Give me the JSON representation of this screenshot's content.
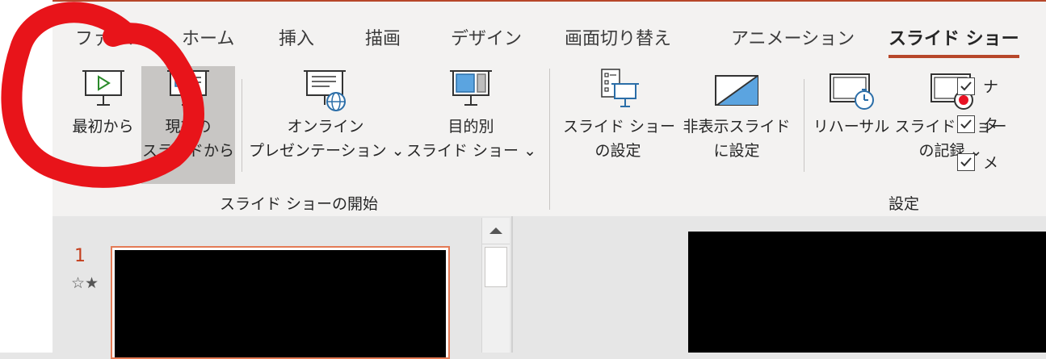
{
  "tabs": [
    {
      "id": "file",
      "label": "ファイル"
    },
    {
      "id": "home",
      "label": "ホーム"
    },
    {
      "id": "insert",
      "label": "挿入"
    },
    {
      "id": "draw",
      "label": "描画"
    },
    {
      "id": "design",
      "label": "デザイン"
    },
    {
      "id": "transitions",
      "label": "画面切り替え"
    },
    {
      "id": "animations",
      "label": "アニメーション"
    },
    {
      "id": "slideshow",
      "label": "スライド ショー",
      "active": true
    }
  ],
  "start_group": {
    "label": "スライド ショーの開始",
    "from_beginning": {
      "line1": "最初から"
    },
    "from_current": {
      "line1": "現在の",
      "line2": "スライドから"
    },
    "online": {
      "line1": "オンライン",
      "line2": "プレゼンテーション ⌄"
    },
    "custom": {
      "line1": "目的別",
      "line2": "スライド ショー ⌄"
    }
  },
  "setup_group": {
    "label": "設定",
    "setup": {
      "line1": "スライド ショー",
      "line2": "の設定"
    },
    "hide": {
      "line1": "非表示スライド",
      "line2": "に設定"
    },
    "rehearse": {
      "line1": "リハーサル"
    },
    "record": {
      "line1": "スライド ショー",
      "line2": "の記録 ⌄"
    }
  },
  "checkboxes": [
    {
      "label": "ナ",
      "checked": true
    },
    {
      "label": "タ",
      "checked": true
    },
    {
      "label": "メ",
      "checked": true
    }
  ],
  "thumbnails": [
    {
      "number": "1",
      "mark": "☆★"
    }
  ],
  "colors": {
    "accent": "#b7472a",
    "annotation": "#e8141a"
  }
}
